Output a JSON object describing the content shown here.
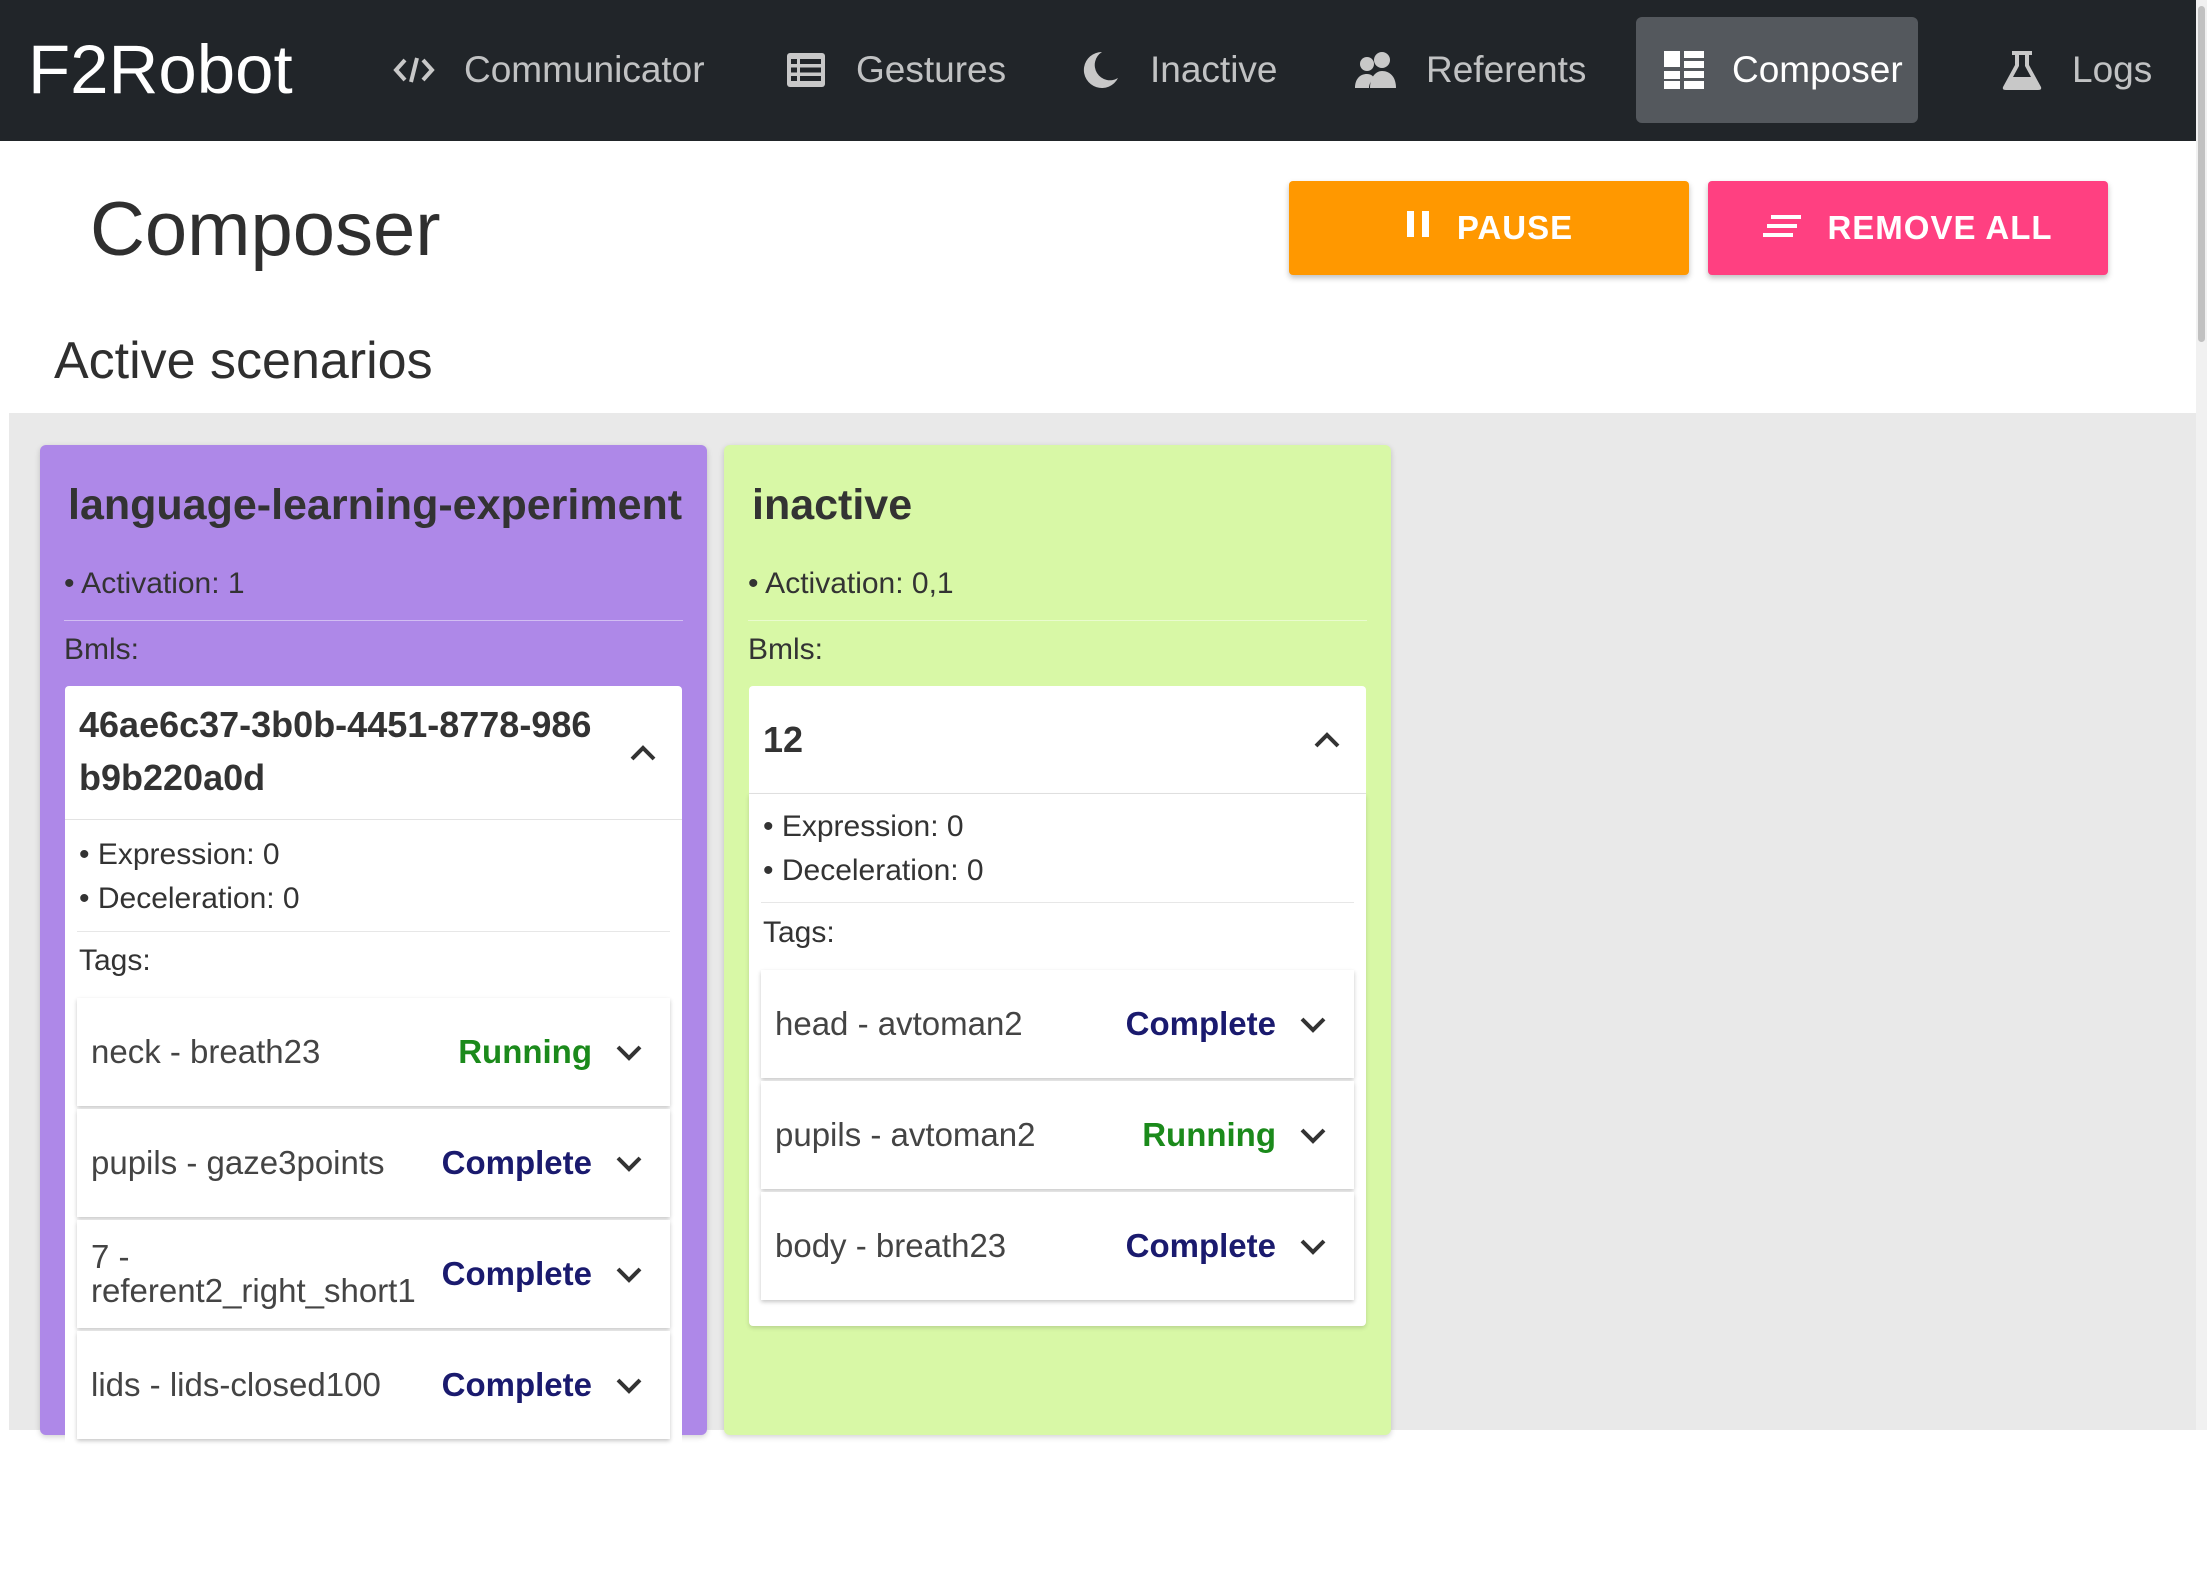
{
  "app": {
    "brand": "F2Robot"
  },
  "nav": {
    "items": [
      {
        "label": "Communicator",
        "icon": "code-icon"
      },
      {
        "label": "Gestures",
        "icon": "list-icon"
      },
      {
        "label": "Inactive",
        "icon": "moon-icon"
      },
      {
        "label": "Referents",
        "icon": "people-icon"
      },
      {
        "label": "Composer",
        "icon": "dashboard-icon",
        "active": true
      },
      {
        "label": "Logs",
        "icon": "flask-icon"
      }
    ]
  },
  "page": {
    "title": "Composer",
    "pause_label": "PAUSE",
    "remove_all_label": "REMOVE ALL",
    "section_title": "Active scenarios"
  },
  "scenarios": [
    {
      "name": "language-learning-experiment",
      "activation": "• Activation: 1",
      "bmls_label": "Bmls:",
      "color": "#ae88e8",
      "bml": {
        "id_line1": "46ae6c37-3b0b-4451-8778-986",
        "id_line2": "b9b220a0d",
        "expression": "• Expression: 0",
        "deceleration": "• Deceleration: 0",
        "tags_label": "Tags:",
        "tags": [
          {
            "name": "neck - breath23",
            "status": "Running"
          },
          {
            "name": "pupils - gaze3points",
            "status": "Complete"
          },
          {
            "name": "7 - referent2_right_short1",
            "status": "Complete"
          },
          {
            "name": "lids - lids-closed100",
            "status": "Complete"
          }
        ]
      }
    },
    {
      "name": "inactive",
      "activation": "• Activation: 0,1",
      "bmls_label": "Bmls:",
      "color": "#d8f8a6",
      "bml": {
        "id_line1": "12",
        "expression": "• Expression: 0",
        "deceleration": "• Deceleration: 0",
        "tags_label": "Tags:",
        "tags": [
          {
            "name": "head - avtoman2",
            "status": "Complete"
          },
          {
            "name": "pupils - avtoman2",
            "status": "Running"
          },
          {
            "name": "body - breath23",
            "status": "Complete"
          }
        ]
      }
    }
  ],
  "colors": {
    "topbar": "#212529",
    "pause": "#ff9800",
    "remove_all": "#ff4081",
    "running": "#1b8a1b",
    "complete": "#1a1a6e"
  }
}
